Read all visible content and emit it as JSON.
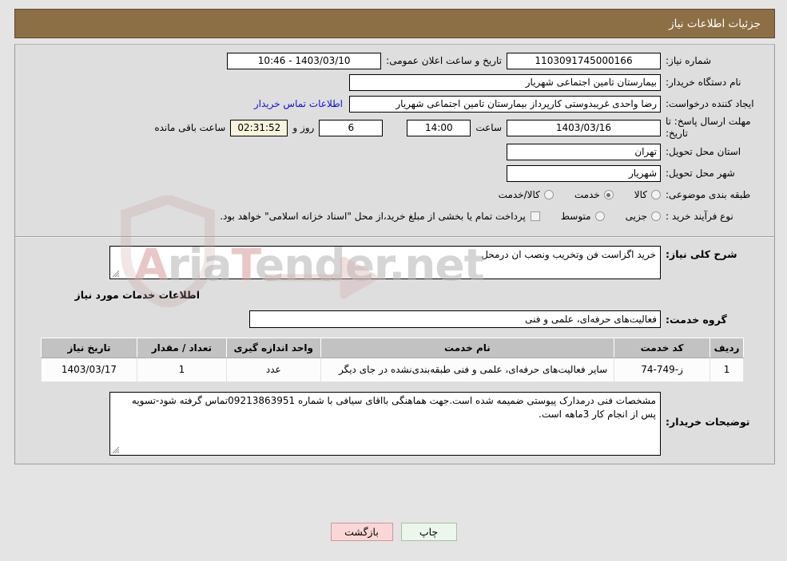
{
  "header": {
    "title": "جزئیات اطلاعات نیاز"
  },
  "brand": {
    "watermark_text_1": "Aria",
    "watermark_text_2": "Tender",
    "watermark_text_3": ".net",
    "header_bg": "#8c6f45",
    "link_color": "#1111cc"
  },
  "form": {
    "need_number_label": "شماره نیاز:",
    "need_number_value": "1103091745000166",
    "public_announce_label": "تاریخ و ساعت اعلان عمومی:",
    "public_announce_value": "1403/03/10 - 10:46",
    "buyer_org_label": "نام دستگاه خریدار:",
    "buyer_org_value": "بیمارستان تامین اجتماعی شهریار",
    "creator_label": "ایجاد کننده درخواست:",
    "creator_value": "رضا واحدی غریبدوستی کارپرداز بیمارستان تامین اجتماعی شهریار",
    "contact_link": "اطلاعات تماس خریدار",
    "deadline_label": "مهلت ارسال پاسخ: تا تاریخ:",
    "deadline_date": "1403/03/16",
    "hour_label": "ساعت",
    "deadline_time": "14:00",
    "days_value": "6",
    "days_label": "روز و",
    "countdown_value": "02:31:52",
    "remaining_label": "ساعت باقی مانده",
    "province_label": "استان محل تحویل:",
    "province_value": "تهران",
    "city_label": "شهر محل تحویل:",
    "city_value": "شهریار",
    "category_label": "طبقه بندی موضوعی:",
    "category_options": [
      {
        "label": "کالا",
        "selected": false
      },
      {
        "label": "خدمت",
        "selected": true
      },
      {
        "label": "کالا/خدمت",
        "selected": false
      }
    ],
    "process_label": "نوع فرآیند خرید :",
    "process_options": [
      {
        "label": "جزیی",
        "selected": false
      },
      {
        "label": "متوسط",
        "selected": false
      }
    ],
    "treasury_checkbox_checked": false,
    "treasury_note": "پرداخت تمام یا بخشی از مبلغ خرید،از محل \"اسناد خزانه اسلامی\" خواهد بود."
  },
  "details": {
    "general_desc_label": "شرح کلی نیاز:",
    "general_desc_value": "خرید اگزاست فن وتخریب ونصب ان درمحل",
    "services_heading": "اطلاعات خدمات مورد نیاز",
    "service_group_label": "گروه خدمت:",
    "service_group_value": "فعالیت‌های حرفه‌ای، علمی و فنی",
    "buyer_notes_label": "توضیحات خریدار:",
    "buyer_notes_value": "مشخصات فنی درمدارک پیوستی ضمیمه شده است.جهت هماهنگی بااقای سیافی با شماره 09213863951تماس گرفته شود-تسویه پس از انجام کار 3ماهه است."
  },
  "table": {
    "columns": [
      "ردیف",
      "کد خدمت",
      "نام خدمت",
      "واحد اندازه گیری",
      "تعداد / مقدار",
      "تاریخ نیاز"
    ],
    "rows": [
      {
        "row_no": "1",
        "service_code": "ز-749-74",
        "service_name": "سایر فعالیت‌های حرفه‌ای، علمی و فنی طبقه‌بندی‌نشده در جای دیگر",
        "unit": "عدد",
        "quantity": "1",
        "need_date": "1403/03/17"
      }
    ]
  },
  "buttons": {
    "print": "چاپ",
    "back": "بازگشت"
  }
}
